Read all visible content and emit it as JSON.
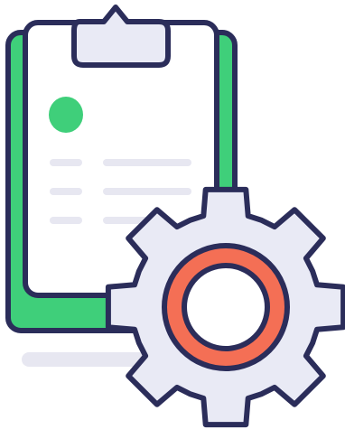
{
  "illustration": {
    "subject": "clipboard-with-settings-gear",
    "icons": [
      "clipboard-icon",
      "gear-icon"
    ],
    "colors": {
      "outline": "#2b2d5a",
      "clipboard_back": "#3fcf7a",
      "paper": "#ffffff",
      "clip": "#e9eaf5",
      "bullet": "#3fcf7a",
      "text_lines": "#e7e7f1",
      "shadow": "#e7e7f1",
      "gear_body": "#e9eaf5",
      "gear_ring": "#f46f55",
      "gear_hole": "#ffffff"
    }
  }
}
